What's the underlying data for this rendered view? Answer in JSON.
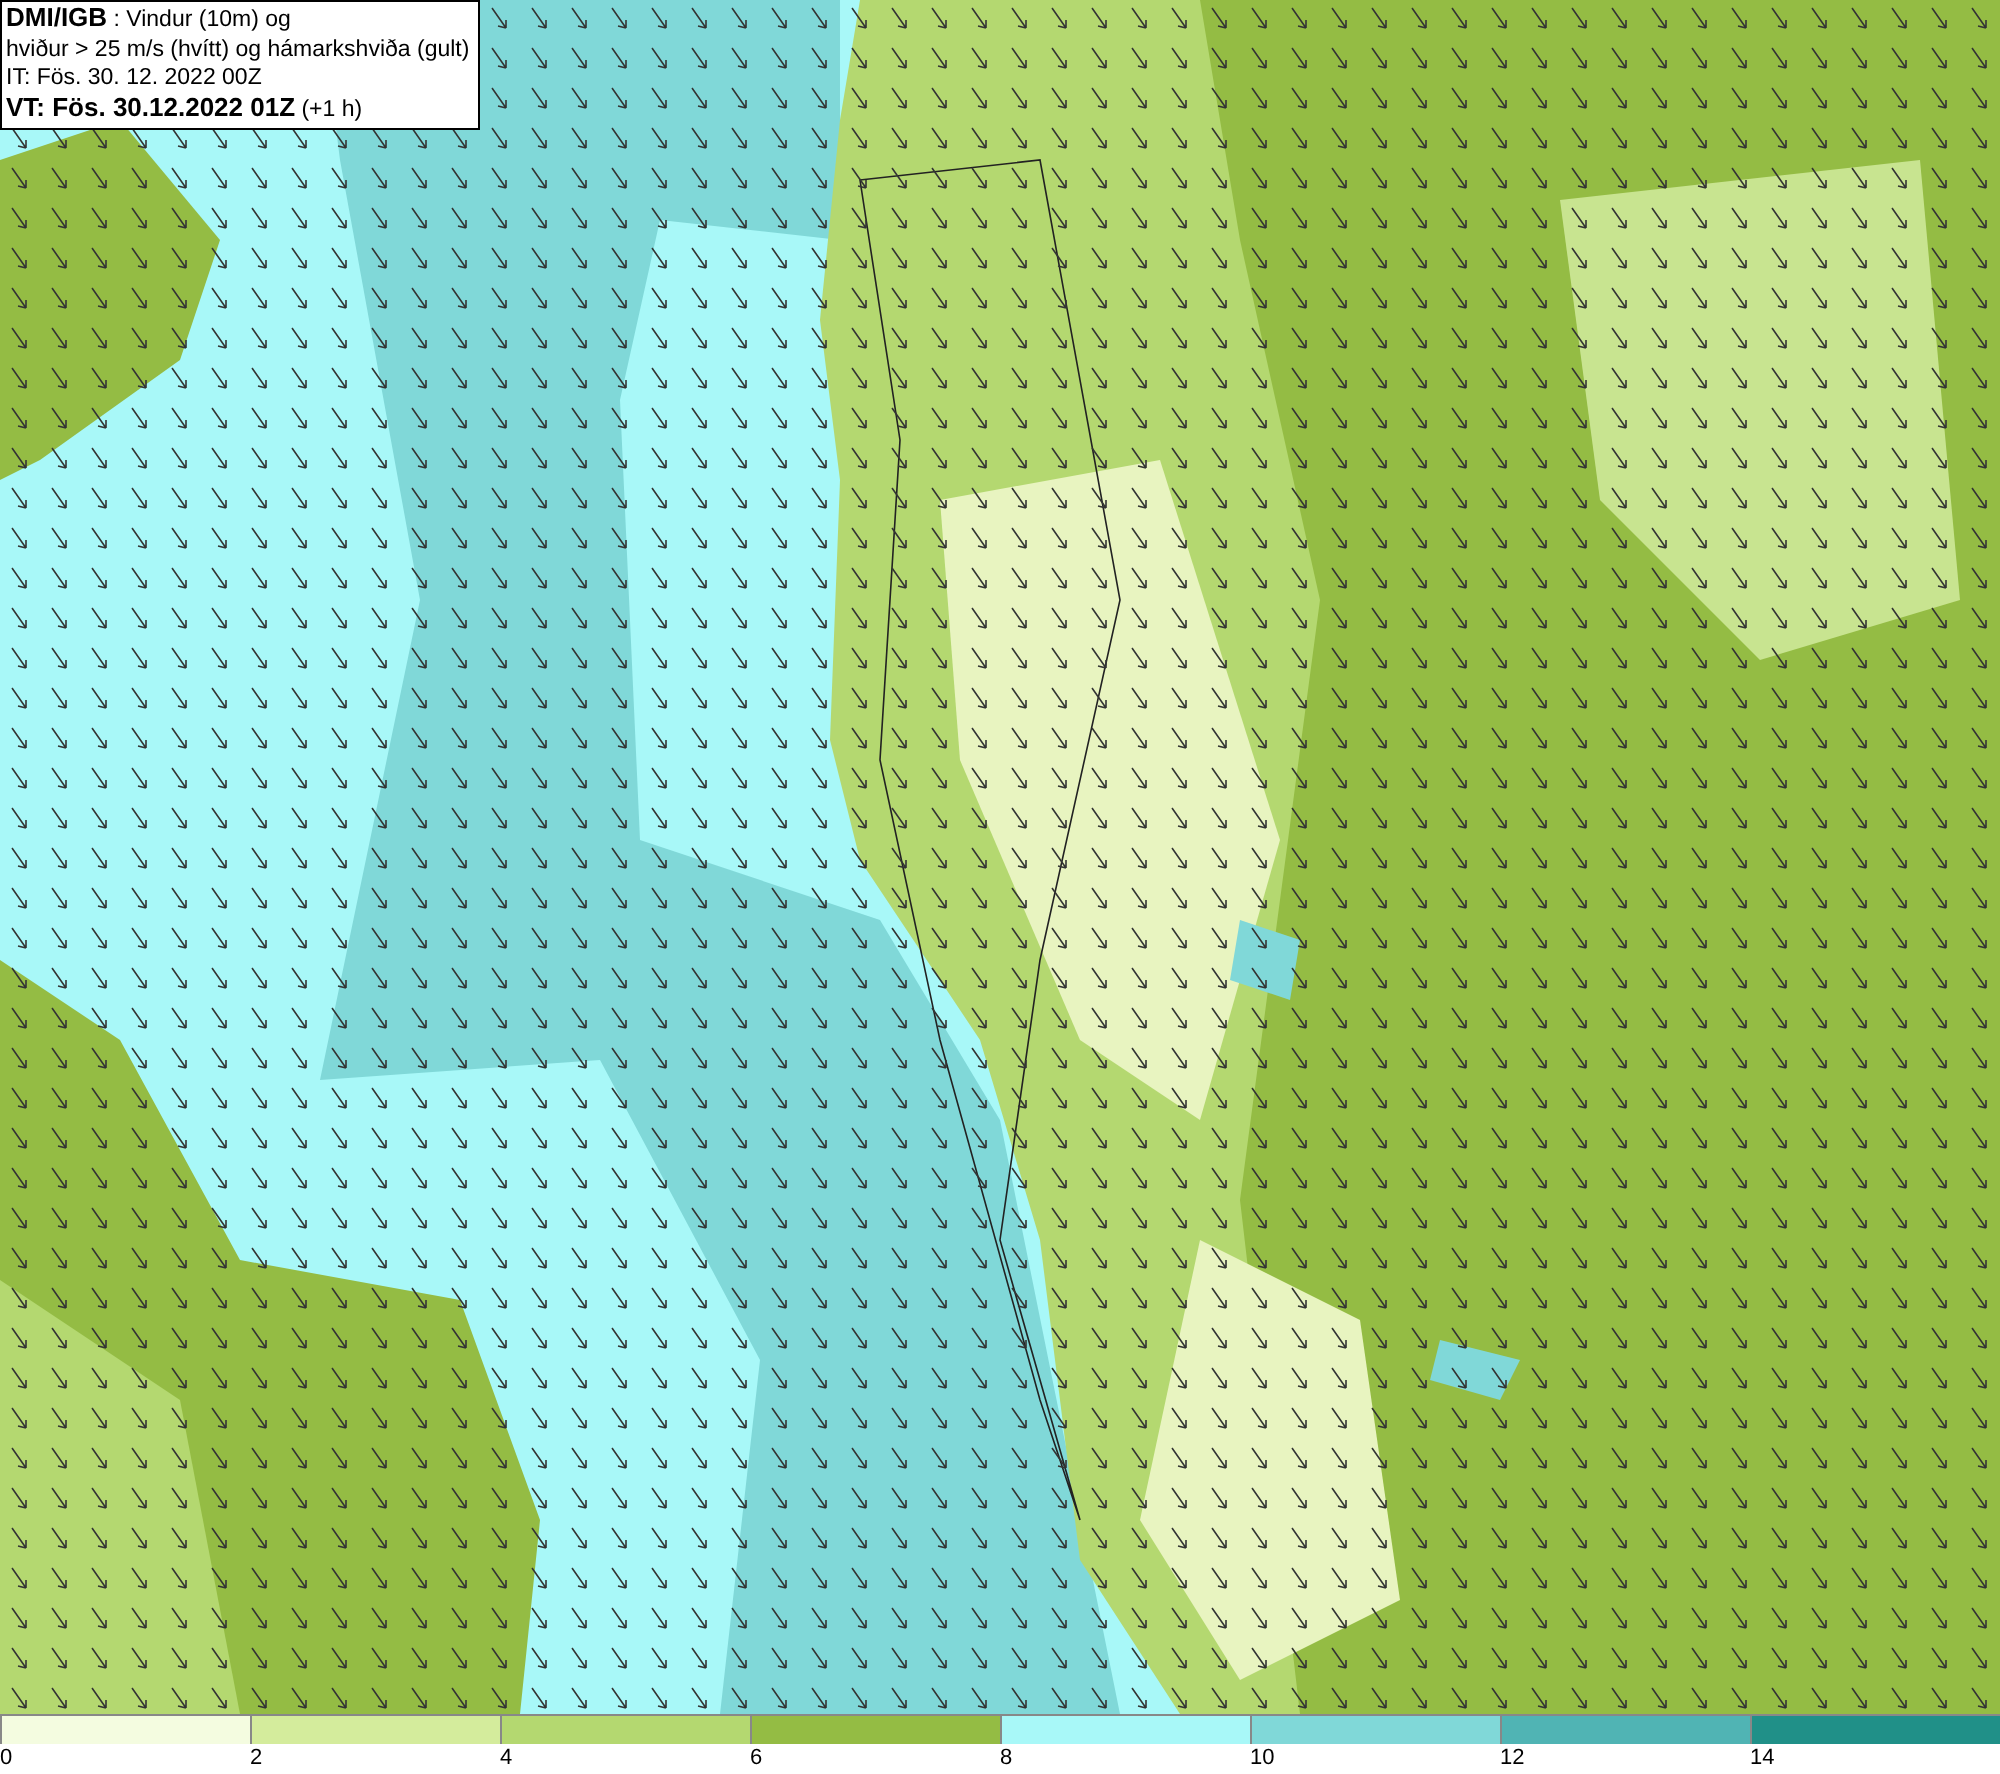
{
  "title_box": {
    "lines": [
      "**DMI/IGB** : Vindur (10m) og",
      "hviður > 25 m/s (hvítt) og hámarkshviða (gult)",
      "IT: Fös. 30. 12. 2022 00Z",
      "**VT: Fös. 30.12.2022 01Z** (+1 h)"
    ]
  },
  "legend": [
    {
      "label": "0",
      "color": "#f4fce0"
    },
    {
      "label": "2",
      "color": "#d4ec9c"
    },
    {
      "label": "4",
      "color": "#b4d870"
    },
    {
      "label": "6",
      "color": "#94bc44"
    },
    {
      "label": "8",
      "color": "#a8f8f8"
    },
    {
      "label": "10",
      "color": "#80d8d8"
    },
    {
      "label": "12",
      "color": "#50b4b4"
    },
    {
      "label": "14",
      "color": "#209088"
    }
  ]
}
